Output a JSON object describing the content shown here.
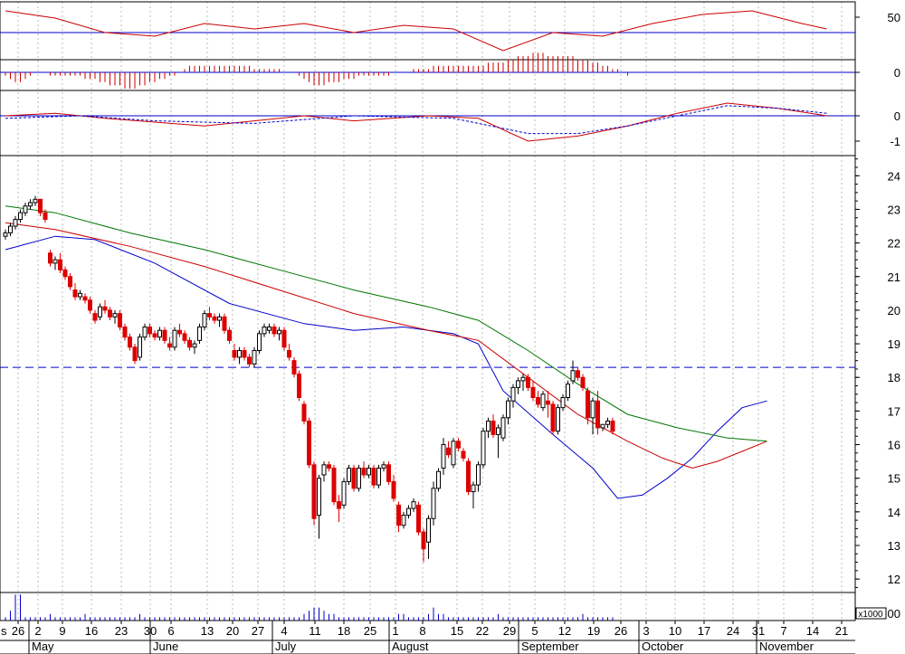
{
  "chart_data": {
    "type": "candlestick",
    "panels": {
      "rsi": {
        "ticks": [
          "50"
        ],
        "ref_level": 50
      },
      "macd_hist": {
        "ticks": [
          "0"
        ]
      },
      "macd": {
        "ticks": [
          "0",
          "-1"
        ]
      },
      "price": {
        "ticks": [
          "24",
          "23",
          "22",
          "21",
          "20",
          "19",
          "18",
          "17",
          "16",
          "15",
          "14",
          "13",
          "12"
        ],
        "ylim": [
          11.6,
          24.6
        ],
        "support_level": 18.3
      },
      "volume": {
        "ticks": [
          "00"
        ],
        "unit_label": "x1000"
      }
    },
    "x_day_labels": [
      "26",
      "2",
      "9",
      "16",
      "23",
      "30",
      "6",
      "13",
      "20",
      "27",
      "4",
      "11",
      "18",
      "25",
      "1",
      "8",
      "15",
      "22",
      "29",
      "5",
      "12",
      "19",
      "26",
      "3",
      "10",
      "17",
      "24",
      "31",
      "7",
      "14",
      "21"
    ],
    "x_month_labels": [
      "May",
      "June",
      "July",
      "August",
      "September",
      "October",
      "November"
    ],
    "candles": [
      [
        22.2,
        22.4,
        22.1,
        22.3
      ],
      [
        22.3,
        22.6,
        22.2,
        22.5
      ],
      [
        22.5,
        22.8,
        22.4,
        22.7
      ],
      [
        22.7,
        23.0,
        22.6,
        22.9
      ],
      [
        22.9,
        23.2,
        22.8,
        23.1
      ],
      [
        23.1,
        23.3,
        23.0,
        23.2
      ],
      [
        23.2,
        23.4,
        23.1,
        23.3
      ],
      [
        23.3,
        23.3,
        22.8,
        22.9
      ],
      [
        22.9,
        23.0,
        22.6,
        22.7
      ],
      [
        21.7,
        21.8,
        21.3,
        21.4
      ],
      [
        21.4,
        21.6,
        21.2,
        21.5
      ],
      [
        21.5,
        21.7,
        21.1,
        21.2
      ],
      [
        21.2,
        21.3,
        20.9,
        21.0
      ],
      [
        21.0,
        21.1,
        20.6,
        20.7
      ],
      [
        20.6,
        20.8,
        20.3,
        20.4
      ],
      [
        20.4,
        20.6,
        20.3,
        20.5
      ],
      [
        20.4,
        20.5,
        20.2,
        20.3
      ],
      [
        20.3,
        20.4,
        19.9,
        20.0
      ],
      [
        19.9,
        20.0,
        19.6,
        19.7
      ],
      [
        19.8,
        20.2,
        19.7,
        20.1
      ],
      [
        20.1,
        20.3,
        19.9,
        20.0
      ],
      [
        20.0,
        20.1,
        19.7,
        19.8
      ],
      [
        19.8,
        20.0,
        19.6,
        19.9
      ],
      [
        19.9,
        20.0,
        19.4,
        19.5
      ],
      [
        19.5,
        19.6,
        19.1,
        19.2
      ],
      [
        19.2,
        19.3,
        18.8,
        18.9
      ],
      [
        18.9,
        19.0,
        18.4,
        18.5
      ],
      [
        18.6,
        19.3,
        18.5,
        19.2
      ],
      [
        19.2,
        19.6,
        19.1,
        19.5
      ],
      [
        19.5,
        19.6,
        19.2,
        19.3
      ],
      [
        19.3,
        19.4,
        19.1,
        19.2
      ],
      [
        19.2,
        19.5,
        19.1,
        19.4
      ],
      [
        19.4,
        19.5,
        19.0,
        19.1
      ],
      [
        19.0,
        19.2,
        18.8,
        18.9
      ],
      [
        18.9,
        19.5,
        18.8,
        19.4
      ],
      [
        19.4,
        19.6,
        19.2,
        19.3
      ],
      [
        19.3,
        19.4,
        19.0,
        19.1
      ],
      [
        19.1,
        19.2,
        18.8,
        18.9
      ],
      [
        18.9,
        19.1,
        18.7,
        19.0
      ],
      [
        19.1,
        19.6,
        19.0,
        19.5
      ],
      [
        19.5,
        20.0,
        19.4,
        19.9
      ],
      [
        19.9,
        20.1,
        19.7,
        19.8
      ],
      [
        19.8,
        19.9,
        19.6,
        19.7
      ],
      [
        19.7,
        19.9,
        19.5,
        19.8
      ],
      [
        19.8,
        19.9,
        19.3,
        19.4
      ],
      [
        19.4,
        19.5,
        19.0,
        19.1
      ],
      [
        18.8,
        19.0,
        18.5,
        18.6
      ],
      [
        18.6,
        18.9,
        18.4,
        18.8
      ],
      [
        18.8,
        18.9,
        18.5,
        18.6
      ],
      [
        18.6,
        18.7,
        18.3,
        18.4
      ],
      [
        18.4,
        18.9,
        18.3,
        18.8
      ],
      [
        18.8,
        19.4,
        18.7,
        19.3
      ],
      [
        19.3,
        19.6,
        19.2,
        19.5
      ],
      [
        19.4,
        19.6,
        19.3,
        19.5
      ],
      [
        19.5,
        19.6,
        19.2,
        19.3
      ],
      [
        19.3,
        19.5,
        19.1,
        19.4
      ],
      [
        19.4,
        19.5,
        18.8,
        18.9
      ],
      [
        18.8,
        19.0,
        18.5,
        18.6
      ],
      [
        18.5,
        18.6,
        18.0,
        18.1
      ],
      [
        18.1,
        18.2,
        17.3,
        17.4
      ],
      [
        17.2,
        17.3,
        16.6,
        16.7
      ],
      [
        16.7,
        16.8,
        15.3,
        15.4
      ],
      [
        15.4,
        15.5,
        13.6,
        13.8
      ],
      [
        13.9,
        15.1,
        13.2,
        15.0
      ],
      [
        15.1,
        15.5,
        14.9,
        15.4
      ],
      [
        15.4,
        15.5,
        15.2,
        15.3
      ],
      [
        15.3,
        15.4,
        14.2,
        14.3
      ],
      [
        14.3,
        14.5,
        13.7,
        14.1
      ],
      [
        14.2,
        15.0,
        14.1,
        14.9
      ],
      [
        14.9,
        15.4,
        14.8,
        15.3
      ],
      [
        15.3,
        15.4,
        14.6,
        14.7
      ],
      [
        14.7,
        15.4,
        14.6,
        15.3
      ],
      [
        15.3,
        15.5,
        15.0,
        15.1
      ],
      [
        15.1,
        15.4,
        15.0,
        15.3
      ],
      [
        15.3,
        15.4,
        14.7,
        14.8
      ],
      [
        14.8,
        15.4,
        14.7,
        15.3
      ],
      [
        15.3,
        15.5,
        15.2,
        15.4
      ],
      [
        15.4,
        15.5,
        14.8,
        14.9
      ],
      [
        14.9,
        15.1,
        14.3,
        14.4
      ],
      [
        14.2,
        14.3,
        13.4,
        13.6
      ],
      [
        13.6,
        14.0,
        13.5,
        13.9
      ],
      [
        13.9,
        14.2,
        13.8,
        14.1
      ],
      [
        14.1,
        14.4,
        14.0,
        14.3
      ],
      [
        14.2,
        14.3,
        13.3,
        13.4
      ],
      [
        13.4,
        13.5,
        12.5,
        12.9
      ],
      [
        13.1,
        13.9,
        12.6,
        13.8
      ],
      [
        13.8,
        14.9,
        13.6,
        14.7
      ],
      [
        14.7,
        15.3,
        14.6,
        15.2
      ],
      [
        15.3,
        16.2,
        15.1,
        16.0
      ],
      [
        15.9,
        16.1,
        15.6,
        15.7
      ],
      [
        15.4,
        16.2,
        15.3,
        16.1
      ],
      [
        16.1,
        16.2,
        15.8,
        15.9
      ],
      [
        15.8,
        15.9,
        15.5,
        15.6
      ],
      [
        15.5,
        15.6,
        14.5,
        14.6
      ],
      [
        14.6,
        14.9,
        14.1,
        14.8
      ],
      [
        14.8,
        15.5,
        14.6,
        15.4
      ],
      [
        15.4,
        16.5,
        15.3,
        16.4
      ],
      [
        16.4,
        16.8,
        16.2,
        16.7
      ],
      [
        16.7,
        16.9,
        16.2,
        16.3
      ],
      [
        16.3,
        16.6,
        15.6,
        16.5
      ],
      [
        16.2,
        16.9,
        16.1,
        16.8
      ],
      [
        16.8,
        17.4,
        16.6,
        17.3
      ],
      [
        17.3,
        17.8,
        17.1,
        17.7
      ],
      [
        17.7,
        18.0,
        17.5,
        17.9
      ],
      [
        17.9,
        18.1,
        17.6,
        18.0
      ],
      [
        18.0,
        18.1,
        17.6,
        17.7
      ],
      [
        17.7,
        17.9,
        17.3,
        17.4
      ],
      [
        17.4,
        17.6,
        17.1,
        17.2
      ],
      [
        17.1,
        17.6,
        17.0,
        17.5
      ],
      [
        17.3,
        17.6,
        16.8,
        17.2
      ],
      [
        17.2,
        17.3,
        16.3,
        16.4
      ],
      [
        16.4,
        17.2,
        16.3,
        17.1
      ],
      [
        17.1,
        17.5,
        17.0,
        17.4
      ],
      [
        17.4,
        17.9,
        17.3,
        17.8
      ],
      [
        17.9,
        18.5,
        17.8,
        18.2
      ],
      [
        18.2,
        18.3,
        17.9,
        18.0
      ],
      [
        18.0,
        18.1,
        17.6,
        17.7
      ],
      [
        17.6,
        17.7,
        16.6,
        16.8
      ],
      [
        16.8,
        17.4,
        16.3,
        17.3
      ],
      [
        17.3,
        17.6,
        16.3,
        16.5
      ],
      [
        16.5,
        16.6,
        16.4,
        16.6
      ],
      [
        16.6,
        16.8,
        16.5,
        16.7
      ],
      [
        16.7,
        16.8,
        16.3,
        16.4
      ]
    ],
    "series": [
      {
        "values": [
          [
            0,
            21.8
          ],
          [
            10,
            22.2
          ],
          [
            18,
            22.1
          ],
          [
            30,
            21.4
          ],
          [
            45,
            20.2
          ],
          [
            60,
            19.6
          ],
          [
            70,
            19.4
          ],
          [
            80,
            19.5
          ],
          [
            90,
            19.3
          ],
          [
            95,
            19.0
          ],
          [
            100,
            17.6
          ],
          [
            110,
            16.3
          ],
          [
            118,
            15.3
          ],
          [
            123,
            14.4
          ],
          [
            128,
            14.5
          ],
          [
            133,
            15.0
          ],
          [
            138,
            15.6
          ],
          [
            143,
            16.4
          ],
          [
            148,
            17.1
          ],
          [
            153,
            17.3
          ]
        ]
      },
      {
        "values": [
          [
            0,
            22.6
          ],
          [
            10,
            22.4
          ],
          [
            25,
            21.9
          ],
          [
            40,
            21.3
          ],
          [
            55,
            20.6
          ],
          [
            70,
            19.9
          ],
          [
            85,
            19.4
          ],
          [
            95,
            19.1
          ],
          [
            105,
            18.0
          ],
          [
            115,
            16.9
          ],
          [
            125,
            16.1
          ],
          [
            132,
            15.6
          ],
          [
            138,
            15.3
          ],
          [
            143,
            15.5
          ],
          [
            148,
            15.8
          ],
          [
            153,
            16.1
          ]
        ]
      },
      {
        "values": [
          [
            0,
            23.1
          ],
          [
            10,
            22.9
          ],
          [
            25,
            22.3
          ],
          [
            40,
            21.8
          ],
          [
            55,
            21.2
          ],
          [
            70,
            20.6
          ],
          [
            85,
            20.1
          ],
          [
            95,
            19.7
          ],
          [
            105,
            18.8
          ],
          [
            115,
            17.8
          ],
          [
            125,
            16.9
          ],
          [
            135,
            16.5
          ],
          [
            145,
            16.2
          ],
          [
            153,
            16.1
          ]
        ]
      }
    ],
    "volume": [
      1,
      3,
      8,
      8,
      1,
      1,
      1,
      1,
      1,
      2,
      1,
      1,
      1,
      1,
      1,
      1,
      2,
      1,
      1,
      1,
      1,
      1,
      1,
      1,
      1,
      1,
      1,
      2,
      1,
      1,
      1,
      1,
      1,
      1,
      1,
      1,
      1,
      1,
      1,
      1,
      1,
      1,
      1,
      1,
      1,
      1,
      1,
      1,
      1,
      1,
      1,
      1,
      1,
      1,
      1,
      1,
      1,
      1,
      1,
      1,
      2,
      3,
      4,
      4,
      3,
      2,
      2,
      1,
      1,
      1,
      1,
      1,
      1,
      1,
      1,
      1,
      1,
      1,
      1,
      2,
      2,
      1,
      1,
      1,
      1,
      2,
      4,
      2,
      2,
      1,
      1,
      1,
      1,
      1,
      1,
      1,
      1,
      1,
      1,
      2,
      1,
      1,
      1,
      1,
      1,
      1,
      1,
      1,
      1,
      1,
      1,
      1,
      1,
      1,
      1,
      1,
      2,
      1,
      1,
      1,
      1,
      1,
      1
    ],
    "macd_hist": [
      -1,
      -2,
      -3,
      -3,
      -2,
      -1,
      0,
      0,
      0,
      -1,
      -1,
      -1,
      -1,
      -1,
      -1,
      -1,
      -2,
      -2,
      -2,
      -3,
      -3,
      -4,
      -4,
      -4,
      -5,
      -5,
      -5,
      -4,
      -4,
      -3,
      -3,
      -2,
      -2,
      -1,
      -1,
      0,
      1,
      2,
      2,
      2,
      2,
      2,
      2,
      2,
      2,
      2,
      2,
      2,
      2,
      2,
      1,
      1,
      1,
      1,
      1,
      1,
      0,
      0,
      0,
      -1,
      -2,
      -3,
      -4,
      -4,
      -4,
      -3,
      -3,
      -3,
      -2,
      -2,
      -2,
      -1,
      -1,
      -1,
      -1,
      -1,
      -1,
      -1,
      0,
      0,
      0,
      0,
      1,
      1,
      1,
      1,
      2,
      2,
      2,
      2,
      2,
      2,
      2,
      2,
      2,
      2,
      2,
      3,
      3,
      3,
      3,
      4,
      4,
      5,
      5,
      5,
      6,
      6,
      6,
      5,
      5,
      5,
      5,
      5,
      5,
      4,
      4,
      4,
      3,
      3,
      2,
      2,
      1,
      1,
      0,
      -1
    ],
    "macd": [
      [
        0,
        0.0
      ],
      [
        10,
        0.1
      ],
      [
        20,
        -0.1
      ],
      [
        40,
        -0.4
      ],
      [
        60,
        0.0
      ],
      [
        70,
        -0.2
      ],
      [
        85,
        0.0
      ],
      [
        95,
        -0.1
      ],
      [
        105,
        -1.0
      ],
      [
        115,
        -0.8
      ],
      [
        125,
        -0.4
      ],
      [
        135,
        0.1
      ],
      [
        145,
        0.5
      ],
      [
        155,
        0.3
      ],
      [
        165,
        0.0
      ]
    ],
    "macd_signal": [
      [
        0,
        -0.1
      ],
      [
        15,
        0.0
      ],
      [
        30,
        -0.2
      ],
      [
        50,
        -0.3
      ],
      [
        70,
        0.0
      ],
      [
        90,
        -0.1
      ],
      [
        105,
        -0.7
      ],
      [
        115,
        -0.7
      ],
      [
        125,
        -0.4
      ],
      [
        135,
        0.0
      ],
      [
        145,
        0.4
      ],
      [
        155,
        0.3
      ],
      [
        165,
        0.1
      ]
    ],
    "rsi": [
      [
        0,
        62
      ],
      [
        10,
        58
      ],
      [
        20,
        50
      ],
      [
        30,
        48
      ],
      [
        40,
        55
      ],
      [
        50,
        52
      ],
      [
        60,
        55
      ],
      [
        70,
        50
      ],
      [
        80,
        54
      ],
      [
        90,
        52
      ],
      [
        100,
        40
      ],
      [
        110,
        50
      ],
      [
        120,
        48
      ],
      [
        130,
        55
      ],
      [
        140,
        60
      ],
      [
        150,
        62
      ],
      [
        160,
        55
      ],
      [
        165,
        52
      ]
    ]
  }
}
